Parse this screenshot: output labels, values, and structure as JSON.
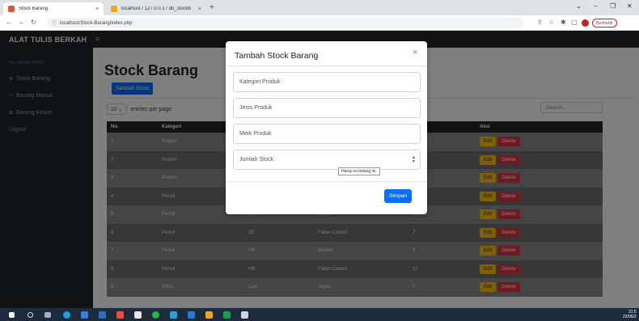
{
  "browser": {
    "tabs": [
      {
        "label": "Stock Barang",
        "active": true
      },
      {
        "label": "localhost / 127.0.0.1 / db_stockb",
        "active": false
      }
    ],
    "new_tab_symbol": "+",
    "url": "localhost/Stock-Barang/index.php",
    "pause_label": "Berhenti"
  },
  "app": {
    "brand": "ALAT TULIS BERKAH",
    "hamburger": "≡",
    "sidebar": {
      "heading": "HALAMAN MENU",
      "items": [
        {
          "label": "Stock Barang",
          "icon": "box-icon"
        },
        {
          "label": "Barang Masuk",
          "icon": "arrow-in-icon"
        },
        {
          "label": "Barang Keluar",
          "icon": "arrow-out-icon"
        },
        {
          "label": "Logout",
          "icon": ""
        }
      ]
    },
    "page_title": "Stock Barang",
    "add_button": "Tambah Stock",
    "per_page_value": "10",
    "per_page_label": "entries per page",
    "search_placeholder": "Search...",
    "table": {
      "headers": [
        "No.",
        "Kategori",
        "",
        "",
        "ok",
        "Aksi"
      ],
      "rows": [
        {
          "no": "1",
          "kategori": "Pulpen",
          "jenis": "",
          "merk": "",
          "stock": ""
        },
        {
          "no": "2",
          "kategori": "Pulpen",
          "jenis": "",
          "merk": "",
          "stock": ""
        },
        {
          "no": "3",
          "kategori": "Pulpen",
          "jenis": "",
          "merk": "",
          "stock": ""
        },
        {
          "no": "4",
          "kategori": "Pensil",
          "jenis": "",
          "merk": "",
          "stock": ""
        },
        {
          "no": "5",
          "kategori": "Pensil",
          "jenis": "2B",
          "merk": "Stadler",
          "stock": "12"
        },
        {
          "no": "6",
          "kategori": "Pensil",
          "jenis": "2B",
          "merk": "Faber-Castell",
          "stock": "7"
        },
        {
          "no": "7",
          "kategori": "Pensil",
          "jenis": "HB",
          "merk": "Stadler",
          "stock": "5"
        },
        {
          "no": "8",
          "kategori": "Pensil",
          "jenis": "HB",
          "merk": "Faber-Castell",
          "stock": "10"
        },
        {
          "no": "9",
          "kategori": "Stipo",
          "jenis": "Cair",
          "merk": "Joyko",
          "stock": "7"
        }
      ],
      "edit_label": "Edit",
      "delete_label": "Delete"
    }
  },
  "modal": {
    "title": "Tambah Stock Barang",
    "close_symbol": "×",
    "fields": [
      {
        "placeholder": "Kategori Produk"
      },
      {
        "placeholder": "Jenis Produk"
      },
      {
        "placeholder": "Merk Produk"
      },
      {
        "placeholder": "Jumlah Stock"
      }
    ],
    "tooltip": "Harap isi bidang ini.",
    "save_label": "Simpan"
  },
  "taskbar": {
    "clock_time": "21:5",
    "clock_date": "22/06/2"
  },
  "colors": {
    "primary": "#0d6efd",
    "warning": "#ffc107",
    "danger": "#dc3545",
    "dark": "#212529"
  }
}
